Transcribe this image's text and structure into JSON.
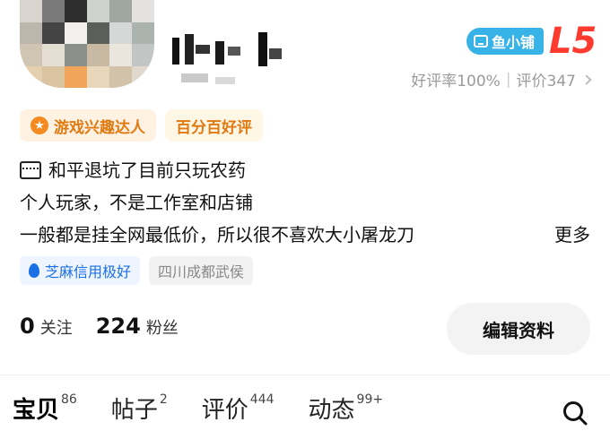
{
  "shop": {
    "badge_label": "鱼小铺",
    "level": "L5"
  },
  "rating": {
    "good_rate": "好评率100%",
    "separator": "|",
    "reviews": "评价347"
  },
  "tags": [
    {
      "label": "游戏兴趣达人",
      "icon": "star-icon"
    },
    {
      "label": "百分百好评"
    }
  ],
  "bio": {
    "line1": "和平退坑了目前只玩农药",
    "line2": "个人玩家，不是工作室和店铺",
    "line3": "一般都是挂全网最低价，所以很不喜欢大小屠龙刀",
    "more": "更多"
  },
  "credit": {
    "sesame": "芝麻信用极好",
    "location": "四川成都武侯"
  },
  "stats": {
    "following_count": "0",
    "following_label": "关注",
    "fans_count": "224",
    "fans_label": "粉丝"
  },
  "edit_button": "编辑资料",
  "tabs": [
    {
      "label": "宝贝",
      "count": "86",
      "active": true
    },
    {
      "label": "帖子",
      "count": "2"
    },
    {
      "label": "评价",
      "count": "444"
    },
    {
      "label": "动态",
      "count": "99+"
    }
  ],
  "colors": {
    "accent_yellow": "#ffe200",
    "shop_blue": "#38b3e8",
    "level_red": "#ff3b30",
    "tag_orange": "#e07a10",
    "credit_blue": "#1b6fe5"
  }
}
